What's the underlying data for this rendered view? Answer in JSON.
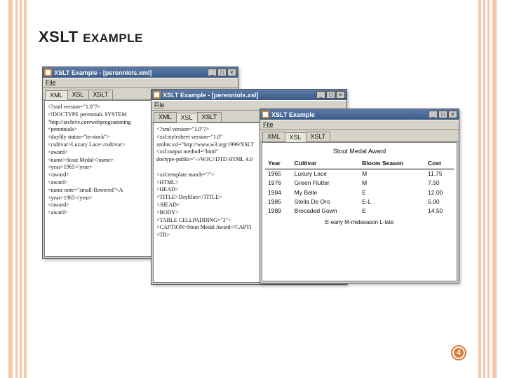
{
  "slide": {
    "title_big": "XSLT",
    "title_small": "EXAMPLE",
    "number": "4"
  },
  "win1": {
    "title": "XSLT Example - [perenniols.xml]",
    "menu": "File",
    "tabs": [
      "XML",
      "XSL",
      "XSLT"
    ],
    "active_tab": 0,
    "code": [
      "<?xml version=\"1.0\"?>",
      "<!DOCTYPE perennials SYSTEM",
      "\"http://archive.corewebprogramming",
      "<perennials>",
      " <daylily status=\"in-stock\">",
      "  <cultivar>Luxury Lace</cultivar>",
      "  <award>",
      "    <name>Stout Medal</name>",
      "    <year>1965</year>",
      "  </award>",
      "  <award>",
      "    <name note=\"small-flowered\">A",
      "    <year>1965</year>",
      "  </award>",
      "  <award>",
      ""
    ]
  },
  "win2": {
    "title": "XSLT Example - [perenniols.xsl]",
    "menu": "File",
    "tabs": [
      "XML",
      "XSL",
      "XSLT"
    ],
    "active_tab": 1,
    "code": [
      "<?xml version=\"1.0\"?>",
      "<xsl:stylesheet version=\"1.0\"",
      "  xmlns:xsl=\"http://www.w3.org/1999/XSLT",
      "<xsl:output method=\"html\"",
      "  doctype-public=\"-//W3C//DTD HTML 4.0",
      "",
      "<xsl:template match=\"/\">",
      "<HTML>",
      "<HEAD>",
      "<TITLE>Daylilies</TITLE>",
      "</HEAD>",
      "<BODY>",
      "<TABLE CELLPADDING=\"3\">",
      "<CAPTION>Stout Medal Award</CAPTI",
      "<TR>"
    ]
  },
  "win3": {
    "title": "XSLT Example",
    "menu": "File",
    "tabs": [
      "XML",
      "XSL",
      "XSLT"
    ],
    "active_tab": 1,
    "caption": "Stout Medal Award",
    "headers": [
      "Year",
      "Cultivar",
      "Bloom Season",
      "Cost"
    ],
    "rows": [
      [
        "1965",
        "Luxury Lace",
        "M",
        "11.75"
      ],
      [
        "1976",
        "Green Flutter",
        "M",
        "7.50"
      ],
      [
        "1984",
        "My Belle",
        "E",
        "12.00"
      ],
      [
        "1985",
        "Stella De Oro",
        "E-L",
        "5.00"
      ],
      [
        "1989",
        "Brocaded Gown",
        "E",
        "14.50"
      ]
    ],
    "footer": "E-early M-midseason L-late"
  },
  "icons": {
    "app": "app-icon",
    "min": "_",
    "max": "□",
    "close": "×"
  }
}
